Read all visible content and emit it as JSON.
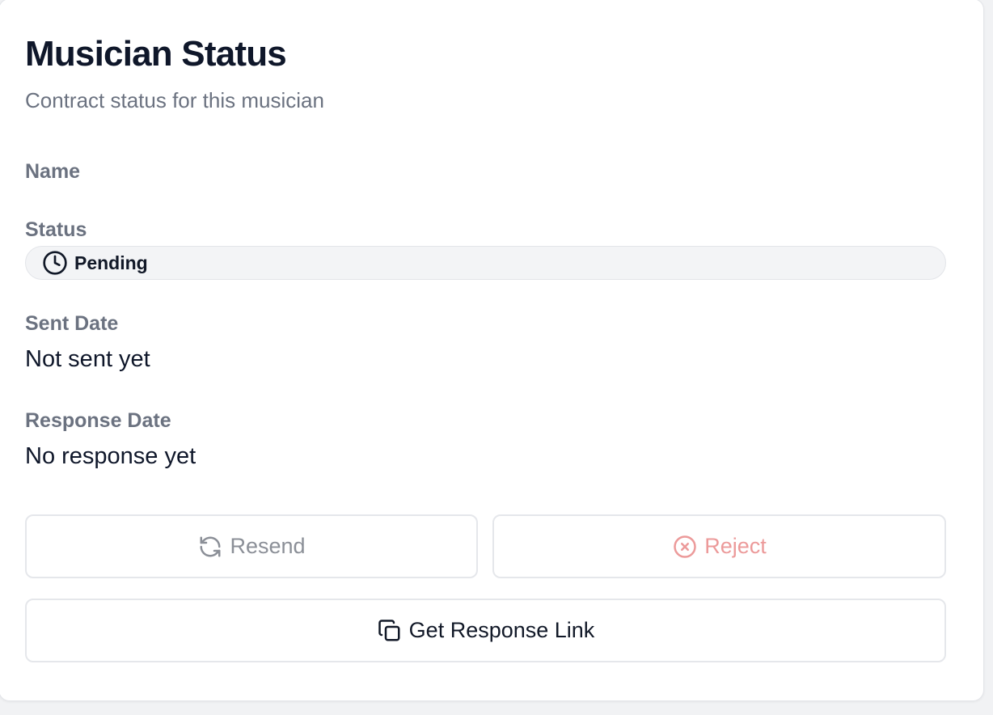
{
  "card": {
    "title": "Musician Status",
    "subtitle": "Contract status for this musician"
  },
  "fields": {
    "name_label": "Name",
    "status_label": "Status",
    "status_value": "Pending",
    "status_icon": "clock-icon",
    "sent_date_label": "Sent Date",
    "sent_date_value": "Not sent yet",
    "response_date_label": "Response Date",
    "response_date_value": "No response yet"
  },
  "actions": {
    "resend_label": "Resend",
    "resend_icon": "refresh-icon",
    "reject_label": "Reject",
    "reject_icon": "x-circle-icon",
    "reject_color": "#ec9a9a",
    "get_link_label": "Get Response Link",
    "get_link_icon": "copy-icon"
  },
  "colors": {
    "title": "#0f172a",
    "muted": "#6b7280",
    "badge_bg": "#f3f4f6",
    "border": "#e5e7eb"
  }
}
